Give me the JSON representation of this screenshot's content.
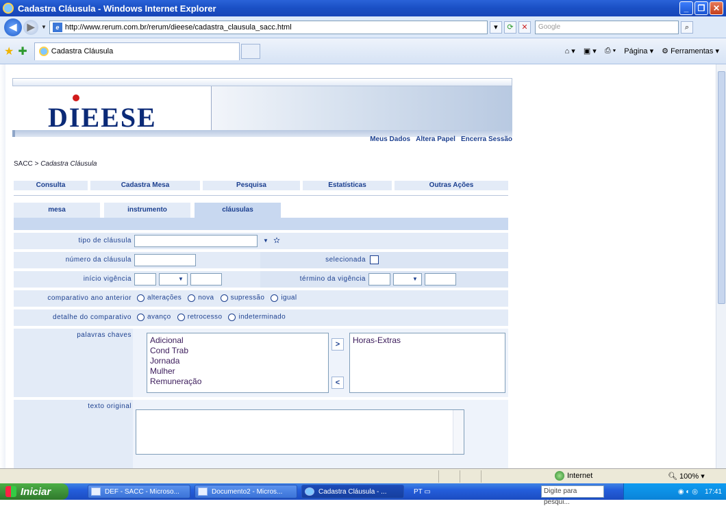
{
  "window": {
    "title": "Cadastra Cláusula - Windows Internet Explorer"
  },
  "address": {
    "url": "http://www.rerum.com.br/rerum/dieese/cadastra_clausula_sacc.html",
    "search_placeholder": "Google"
  },
  "tab": {
    "label": "Cadastra Cláusula"
  },
  "toolbar": {
    "page_label": "Página",
    "tools_label": "Ferramentas"
  },
  "banner": {
    "logo": "DIEESE",
    "links": [
      "Meus Dados",
      "Altera Papel",
      "Encerra Sessão"
    ]
  },
  "breadcrumb": {
    "root": "SACC",
    "sep": ">",
    "current": "Cadastra Cláusula"
  },
  "menu": [
    "Consulta",
    "Cadastra Mesa",
    "Pesquisa",
    "Estatísticas",
    "Outras Ações"
  ],
  "subtabs": [
    "mesa",
    "instrumento",
    "cláusulas"
  ],
  "form": {
    "tipo_label": "tipo de cláusula",
    "numero_label": "número da cláusula",
    "selecionada_label": "selecionada",
    "inicio_label": "início vigência",
    "termino_label": "término da vigência",
    "comparativo_label": "comparativo ano anterior",
    "comparativo_options": [
      "alterações",
      "nova",
      "supressão",
      "igual"
    ],
    "detalhe_label": "detalhe do comparativo",
    "detalhe_options": [
      "avanço",
      "retrocesso",
      "indeterminado"
    ],
    "palavras_label": "palavras chaves",
    "palavras_disponiveis": [
      "Adicional",
      "Cond Trab",
      "Jornada",
      "Mulher",
      "Remuneração"
    ],
    "palavras_selecionadas": [
      "Horas-Extras"
    ],
    "add_button": ">",
    "remove_button": "<",
    "texto_label": "texto original"
  },
  "status": {
    "zone": "Internet",
    "zoom": "100%"
  },
  "taskbar": {
    "start": "Iniciar",
    "items": [
      "DEF - SACC - Microso...",
      "Documento2 - Micros...",
      "Cadastra Cláusula - ..."
    ],
    "lang": "PT",
    "search": "Digite para pesqui...",
    "clock": "17:41"
  }
}
